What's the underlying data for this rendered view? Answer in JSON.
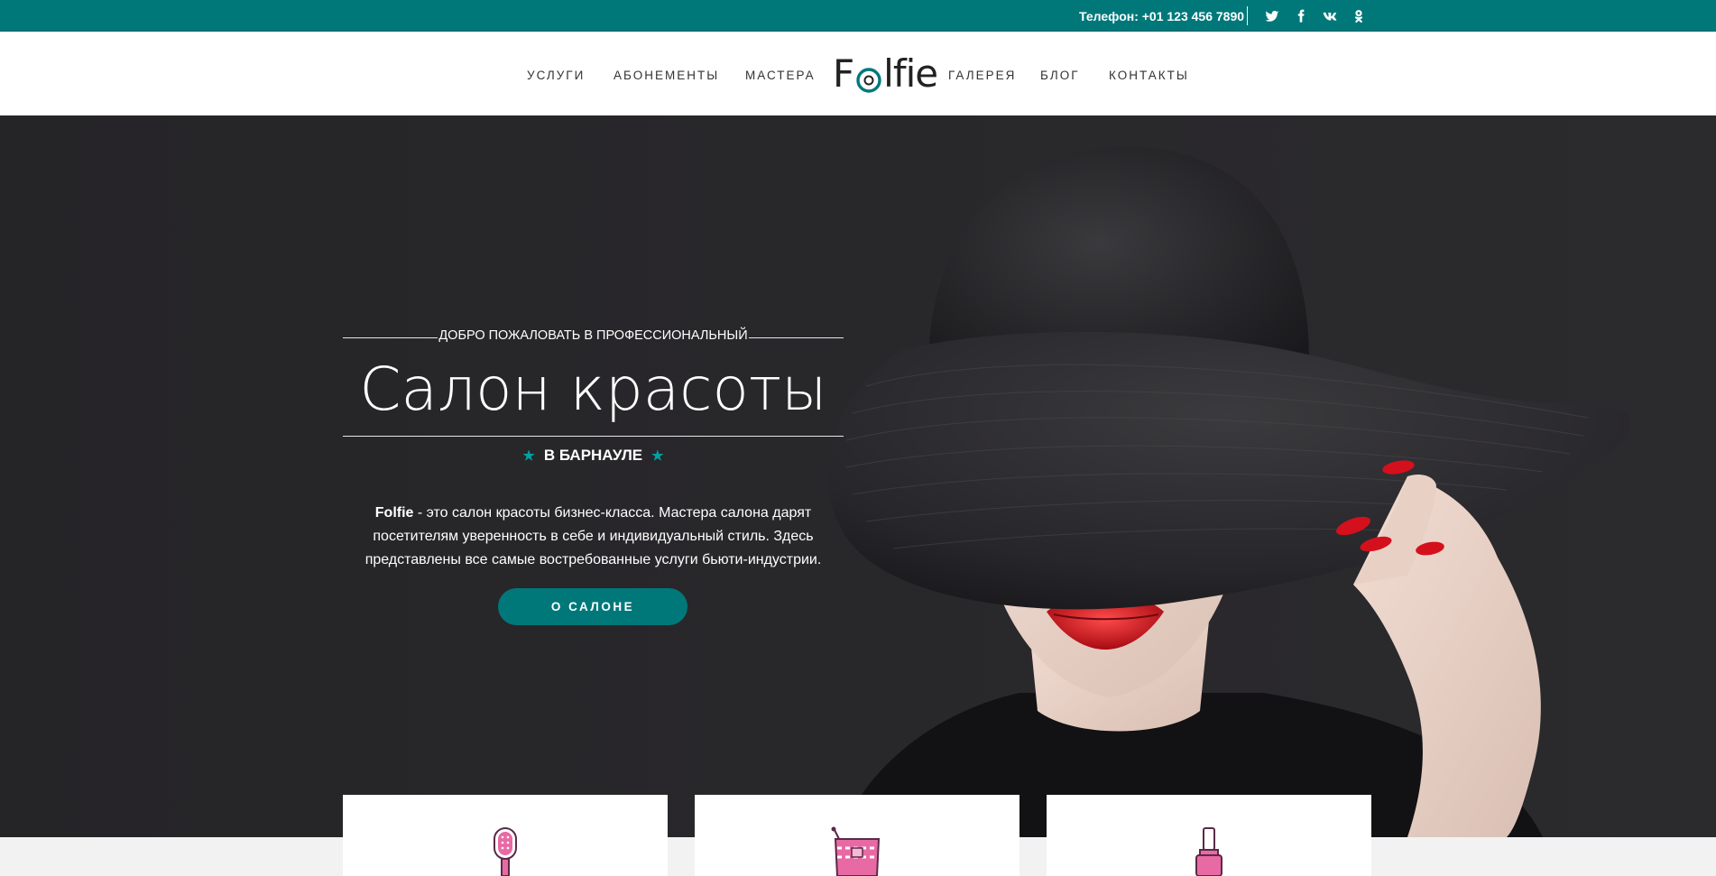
{
  "topbar": {
    "phone_text": "Телефон: +01 123 456 7890",
    "social": [
      {
        "icon": "twitter-icon"
      },
      {
        "icon": "facebook-icon"
      },
      {
        "icon": "vk-icon"
      },
      {
        "icon": "odnoklassniki-icon"
      }
    ],
    "bg_color": "#00787a"
  },
  "nav": {
    "left": [
      "УСЛУГИ",
      "АБОНЕМЕНТЫ",
      "МАСТЕРА"
    ],
    "right": [
      "ГАЛЕРЕЯ",
      "БЛОГ",
      "КОНТАКТЫ"
    ],
    "logo_pre": "F",
    "logo_post": "lfie"
  },
  "hero": {
    "welcome": "ДОБРО ПОЖАЛОВАТЬ В ПРОФЕССИОНАЛЬНЫЙ",
    "title": "Салон красоты",
    "subtitle": "В БАРНАУЛЕ",
    "desc_brand": "Folfie",
    "desc_rest": " - это салон красоты бизнес-класса. Мастера салона дарят посетителям уверенность в себе и индивидуальный стиль. Здесь представлены все самые востребованные услуги бьюти-индустрии.",
    "button": "О САЛОНЕ",
    "accent_color": "#00787a"
  },
  "cards": [
    {
      "icon": "hairbrush-icon"
    },
    {
      "icon": "cosmetic-bag-icon"
    },
    {
      "icon": "nail-polish-icon"
    }
  ]
}
